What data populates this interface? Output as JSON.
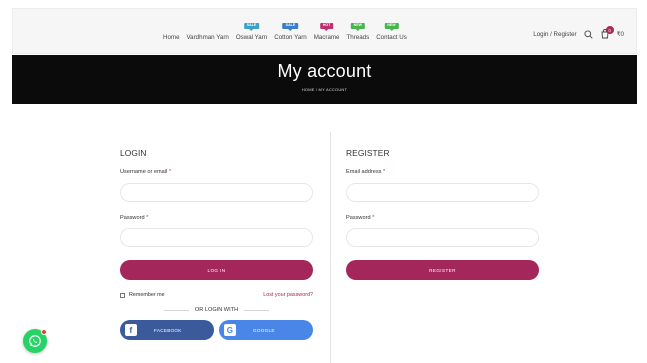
{
  "header": {
    "nav": [
      {
        "label": "Home",
        "badge": null
      },
      {
        "label": "Vardhman Yarn",
        "badge": null
      },
      {
        "label": "Oswal Yarn",
        "badge": "SALE",
        "badge_color": "#3aa1c9"
      },
      {
        "label": "Cotton Yarn",
        "badge": "SALE",
        "badge_color": "#3a7ec9"
      },
      {
        "label": "Macrame",
        "badge": "HOT",
        "badge_color": "#c02e6e"
      },
      {
        "label": "Threads",
        "badge": "NEW",
        "badge_color": "#45b649"
      },
      {
        "label": "Contact Us",
        "badge": "NEW",
        "badge_color": "#45b649"
      }
    ],
    "account_link": "Login / Register",
    "search_icon": "search-icon",
    "cart_icon": "cart-icon",
    "cart_count": "0",
    "cart_total": "₹0"
  },
  "titlebar": {
    "title": "My account",
    "breadcrumb": "HOME / MY ACCOUNT"
  },
  "login": {
    "heading": "LOGIN",
    "username_label": "Username or email",
    "password_label": "Password",
    "required_mark": "*",
    "username_value": "",
    "password_value": "",
    "submit_label": "LOG IN",
    "remember_label": "Remember me",
    "lost_password": "Lost your password?",
    "or_login_with": "OR LOGIN WITH",
    "facebook_label": "FACEBOOK",
    "google_label": "GOOGLE",
    "facebook_glyph": "f",
    "google_glyph": "G"
  },
  "register": {
    "heading": "REGISTER",
    "email_label": "Email address",
    "password_label": "Password",
    "required_mark": "*",
    "email_value": "",
    "password_value": "",
    "submit_label": "REGISTER"
  },
  "colors": {
    "accent": "#a3275a",
    "facebook": "#3b5a9b",
    "google": "#4a86e8",
    "whatsapp": "#25d366"
  }
}
